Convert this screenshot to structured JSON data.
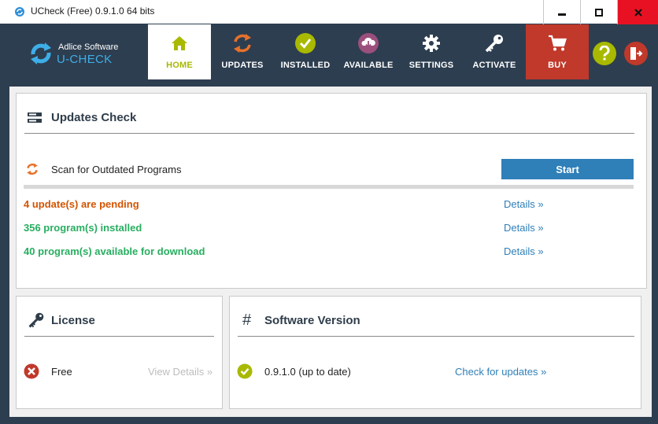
{
  "window": {
    "title": "UCheck (Free) 0.9.1.0 64 bits"
  },
  "brand": {
    "company": "Adlice Software",
    "product": "U-CHECK"
  },
  "tabs": [
    {
      "id": "home",
      "label": "HOME",
      "icon": "home-icon",
      "active": true
    },
    {
      "id": "updates",
      "label": "UPDATES",
      "icon": "sync-icon"
    },
    {
      "id": "installed",
      "label": "INSTALLED",
      "icon": "check-circle-icon"
    },
    {
      "id": "available",
      "label": "AVAILABLE",
      "icon": "cloud-download-icon"
    },
    {
      "id": "settings",
      "label": "SETTINGS",
      "icon": "gear-icon"
    },
    {
      "id": "activate",
      "label": "ACTIVATE",
      "icon": "key-icon"
    },
    {
      "id": "buy",
      "label": "BUY",
      "icon": "cart-icon"
    }
  ],
  "updates_check": {
    "title": "Updates Check",
    "scan_label": "Scan for Outdated Programs",
    "start_label": "Start",
    "progress": 0,
    "pending": "4 update(s) are pending",
    "installed": "356 program(s) installed",
    "available": "40 program(s) available for download",
    "details_label": "Details »"
  },
  "license": {
    "title": "License",
    "value": "Free",
    "details_label": "View Details »"
  },
  "software_version": {
    "title": "Software Version",
    "symbol": "#",
    "value": "0.9.1.0 (up to date)",
    "check_label": "Check for updates »"
  },
  "colors": {
    "dark": "#2d3e50",
    "accent_green": "#a8b900",
    "pending": "#d35400",
    "ok_green": "#27ae60",
    "link": "#2f7fb8",
    "buy": "#c0392b",
    "error": "#c0392b"
  }
}
